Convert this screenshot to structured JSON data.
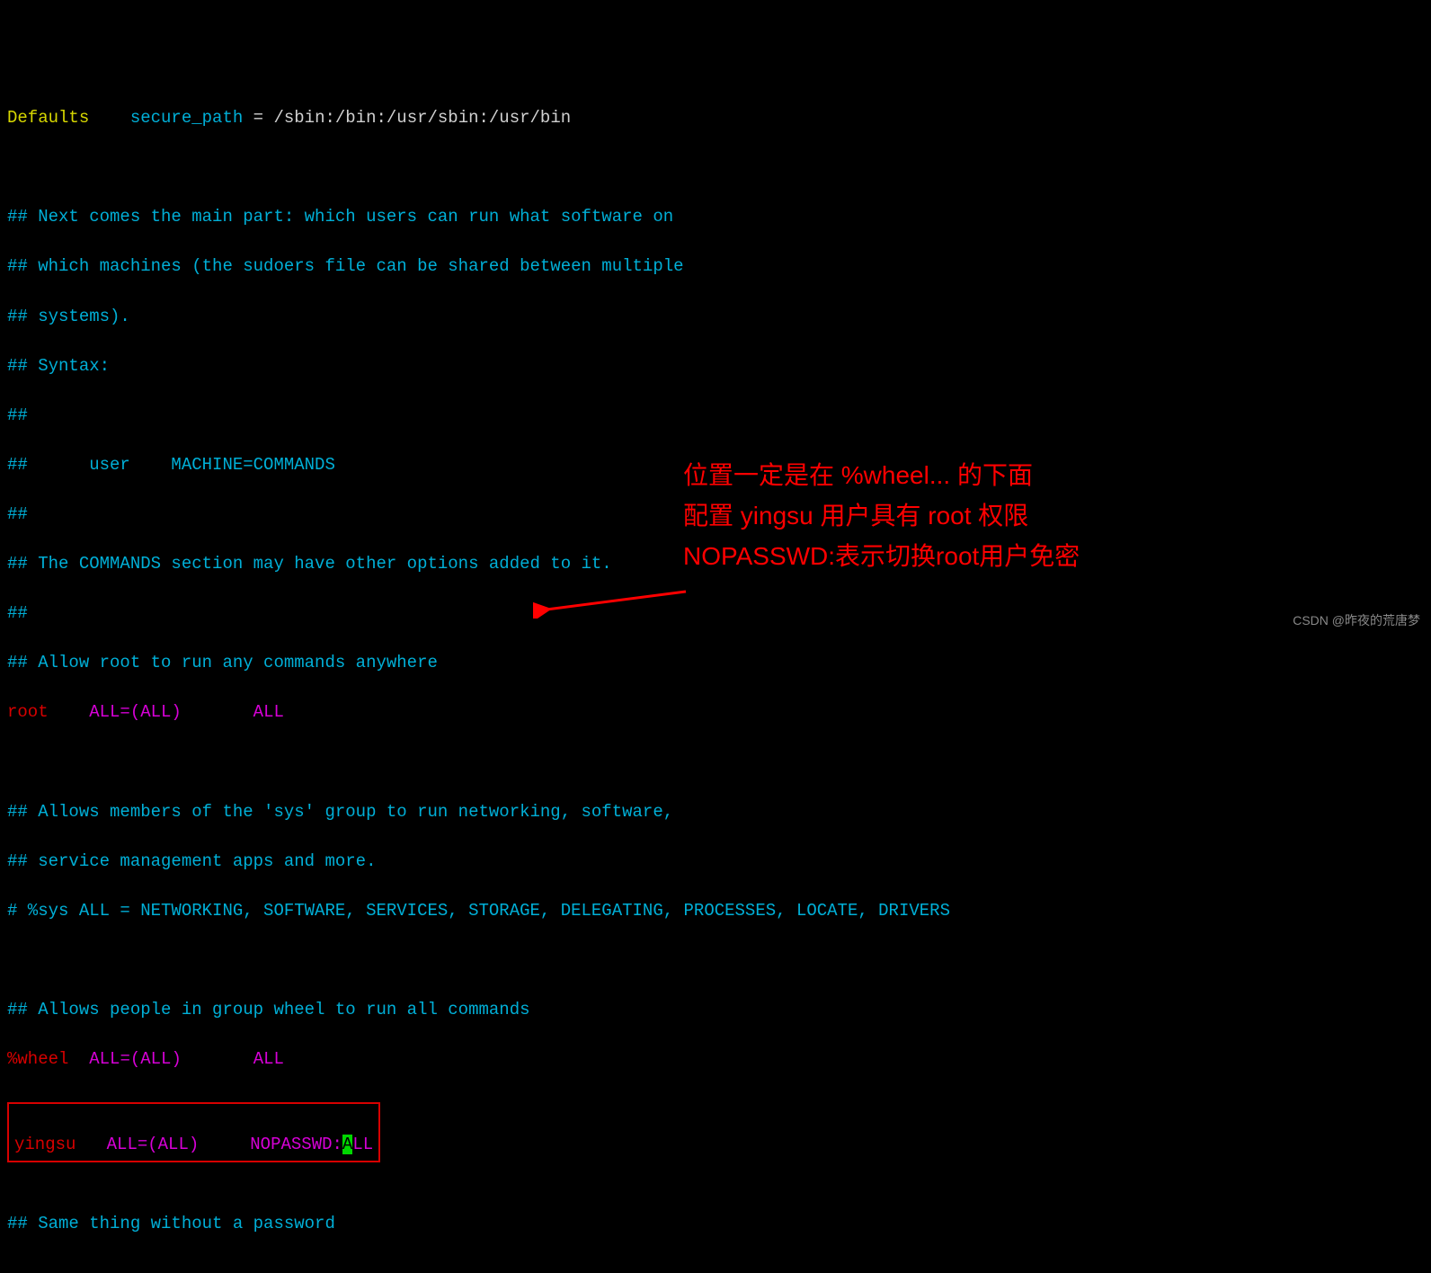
{
  "line1": {
    "defaults": "Defaults",
    "secure_path": "secure_path",
    "equals": " = ",
    "path": "/sbin:/bin:/usr/sbin:/usr/bin"
  },
  "comments": {
    "c1": "## Next comes the main part: which users can run what software on",
    "c2": "## which machines (the sudoers file can be shared between multiple",
    "c3": "## systems).",
    "c4": "## Syntax:",
    "c5": "##",
    "c6": "##      user    MACHINE=COMMANDS",
    "c7": "##",
    "c8": "## The COMMANDS section may have other options added to it.",
    "c9": "##",
    "c10": "## Allow root to run any commands anywhere",
    "c11": "## Allows members of the 'sys' group to run networking, software,",
    "c12": "## service management apps and more.",
    "c13": "# %sys ALL = NETWORKING, SOFTWARE, SERVICES, STORAGE, DELEGATING, PROCESSES, LOCATE, DRIVERS",
    "c14": "## Allows people in group wheel to run all commands",
    "c15": "## Same thing without a password"
  },
  "root_line": {
    "user": "root",
    "spec": "ALL=(ALL)",
    "cmd": "ALL"
  },
  "wheel_line": {
    "group": "%wheel",
    "spec": "ALL=(ALL)",
    "cmd": "ALL"
  },
  "yingsu_line": {
    "user": "yingsu",
    "spec": "ALL=(ALL)",
    "nopass": "NOPASSWD:",
    "cursor": "A",
    "rest": "LL"
  },
  "annotations": {
    "a1": "位置一定是在 %wheel... 的下面",
    "a2": "配置 yingsu 用户具有 root 权限",
    "a3": "NOPASSWD:表示切换root用户免密"
  },
  "watermark": "CSDN @昨夜的荒唐梦"
}
